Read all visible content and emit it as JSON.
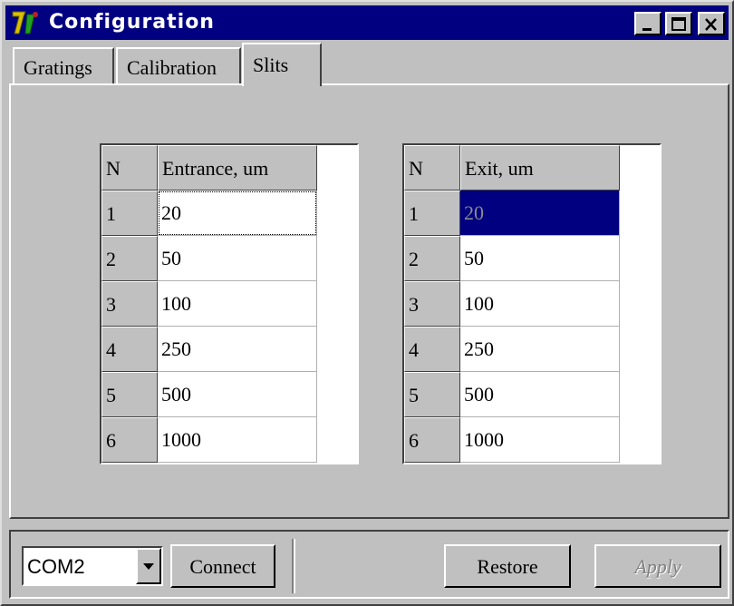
{
  "window": {
    "title": "Configuration",
    "minimize_icon": "minimize-icon",
    "maximize_icon": "maximize-icon",
    "close_icon": "close-icon"
  },
  "tabs": [
    {
      "label": "Gratings",
      "active": false
    },
    {
      "label": "Calibration",
      "active": false
    },
    {
      "label": "Slits",
      "active": true
    }
  ],
  "entrance_table": {
    "header_n": "N",
    "header_value": "Entrance, um",
    "rows": [
      {
        "n": "1",
        "value": "20"
      },
      {
        "n": "2",
        "value": "50"
      },
      {
        "n": "3",
        "value": "100"
      },
      {
        "n": "4",
        "value": "250"
      },
      {
        "n": "5",
        "value": "500"
      },
      {
        "n": "6",
        "value": "1000"
      }
    ]
  },
  "exit_table": {
    "header_n": "N",
    "header_value": "Exit, um",
    "rows": [
      {
        "n": "1",
        "value": "20"
      },
      {
        "n": "2",
        "value": "50"
      },
      {
        "n": "3",
        "value": "100"
      },
      {
        "n": "4",
        "value": "250"
      },
      {
        "n": "5",
        "value": "500"
      },
      {
        "n": "6",
        "value": "1000"
      }
    ]
  },
  "bottom": {
    "port_value": "COM2",
    "connect_label": "Connect",
    "restore_label": "Restore",
    "apply_label": "Apply"
  },
  "colors": {
    "titlebar": "#000080",
    "face": "#c0c0c0",
    "selection": "#000080"
  }
}
